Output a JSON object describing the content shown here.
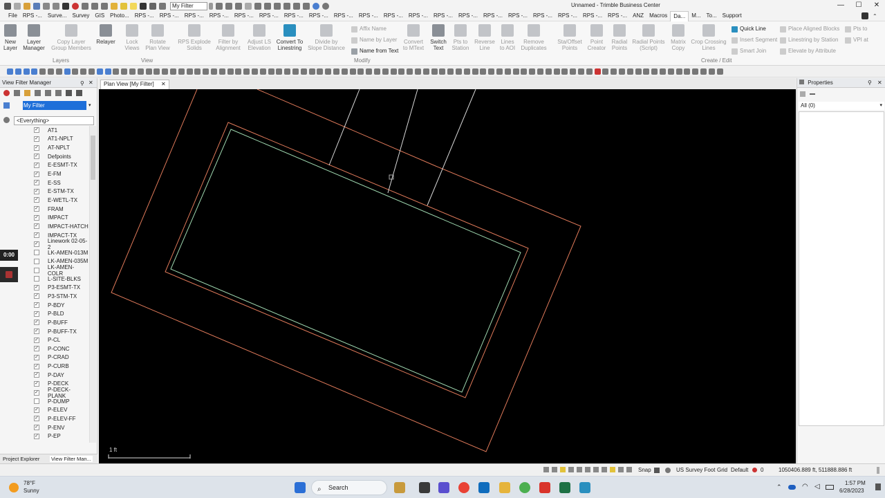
{
  "titlebar": {
    "filter_value": "My Filter",
    "app_title": "Unnamed - Trimble Business Center",
    "min": "—",
    "max": "☐",
    "close": "✕"
  },
  "menu": {
    "items": [
      "File",
      "RPS -...",
      "Surve...",
      "Survey",
      "GIS",
      "Photo...",
      "RPS -...",
      "RPS -...",
      "RPS -...",
      "RPS -...",
      "RPS -...",
      "RPS -...",
      "RPS -...",
      "RPS -...",
      "RPS -...",
      "RPS -...",
      "RPS -...",
      "RPS -...",
      "RPS -...",
      "RPS -...",
      "RPS -...",
      "RPS -...",
      "RPS -...",
      "RPS -...",
      "RPS -...",
      "RPS -...",
      "ANZ",
      "Macros",
      "Da...",
      "M...",
      "To...",
      "Support"
    ],
    "active_index": 28
  },
  "ribbon": {
    "layers": [
      {
        "label": "New\nLayer"
      },
      {
        "label": "Layer\nManager"
      },
      {
        "label": "Copy Layer\nGroup Members"
      },
      {
        "label": "Relayer"
      }
    ],
    "view": [
      {
        "label": "Lock\nViews"
      },
      {
        "label": "Rotate\nPlan View"
      }
    ],
    "modify": [
      {
        "label": "RPS Explode\nSolids"
      },
      {
        "label": "Filter by\nAlignment"
      },
      {
        "label": "Adjust LS\nElevation"
      },
      {
        "label": "Convert To\nLinestring"
      },
      {
        "label": "Divide by\nSlope Distance"
      }
    ],
    "modify_small": [
      "Affix Name",
      "Name by Layer",
      "Name from Text"
    ],
    "modify2": [
      {
        "label": "Convert\nto MText"
      },
      {
        "label": "Switch\nText"
      },
      {
        "label": "Pts to\nStation"
      },
      {
        "label": "Reverse\nLine"
      },
      {
        "label": "Lines\nto AOI"
      },
      {
        "label": "Remove\nDuplicates"
      }
    ],
    "create": [
      {
        "label": "Sta/Offset\nPoints"
      },
      {
        "label": "Point\nCreator"
      },
      {
        "label": "Radial\nPoints"
      },
      {
        "label": "Radial Points\n(Script)"
      },
      {
        "label": "Matrix\nCopy"
      },
      {
        "label": "Crop Crossing\nLines"
      }
    ],
    "create_small": [
      "Quick Line",
      "Insert Segment",
      "Smart Join"
    ],
    "create_small2": [
      "Place Aligned Blocks",
      "Linestring by Station",
      "Elevate by Attribute"
    ],
    "create_small3": [
      "Pts to",
      "VPI at"
    ],
    "group_layers": "Layers",
    "group_view": "View",
    "group_modify": "Modify",
    "group_create": "Create / Edit"
  },
  "left_panel": {
    "title": "View Filter Manager",
    "filter_name": "My Filter",
    "everything": "<Everything>",
    "timer": "0:00",
    "layers": [
      {
        "name": "AT1",
        "checked": true
      },
      {
        "name": "AT1-NPLT",
        "checked": true
      },
      {
        "name": "AT-NPLT",
        "checked": true
      },
      {
        "name": "Defpoints",
        "checked": true
      },
      {
        "name": "E-ESMT-TX",
        "checked": true
      },
      {
        "name": "E-FM",
        "checked": true
      },
      {
        "name": "E-SS",
        "checked": true
      },
      {
        "name": "E-STM-TX",
        "checked": true
      },
      {
        "name": "E-WETL-TX",
        "checked": true
      },
      {
        "name": "FRAM",
        "checked": true
      },
      {
        "name": "IMPACT",
        "checked": true
      },
      {
        "name": "IMPACT-HATCH",
        "checked": true
      },
      {
        "name": "IMPACT-TX",
        "checked": true
      },
      {
        "name": "Linework 02-05-2",
        "checked": true
      },
      {
        "name": "LK-AMEN-013M",
        "checked": false
      },
      {
        "name": "LK-AMEN-035M",
        "checked": false
      },
      {
        "name": "LK-AMEN-COLR",
        "checked": false
      },
      {
        "name": "L-SITE-BLKS",
        "checked": false
      },
      {
        "name": "P3-ESMT-TX",
        "checked": true
      },
      {
        "name": "P3-STM-TX",
        "checked": true
      },
      {
        "name": "P-BDY",
        "checked": true
      },
      {
        "name": "P-BLD",
        "checked": true
      },
      {
        "name": "P-BUFF",
        "checked": true
      },
      {
        "name": "P-BUFF-TX",
        "checked": true
      },
      {
        "name": "P-CL",
        "checked": true
      },
      {
        "name": "P-CONC",
        "checked": true
      },
      {
        "name": "P-CRAD",
        "checked": true
      },
      {
        "name": "P-CURB",
        "checked": true
      },
      {
        "name": "P-DAY",
        "checked": true
      },
      {
        "name": "P-DECK",
        "checked": true
      },
      {
        "name": "P-DECK-PLANK",
        "checked": true
      },
      {
        "name": "P-DUMP",
        "checked": false
      },
      {
        "name": "P-ELEV",
        "checked": true
      },
      {
        "name": "P-ELEV-FF",
        "checked": true
      },
      {
        "name": "P-ENV",
        "checked": true
      },
      {
        "name": "P-EP",
        "checked": true
      }
    ],
    "bottom_tabs": [
      "Project Explorer",
      "View Filter Man..."
    ]
  },
  "canvas": {
    "tab_label": "Plan View [My Filter]",
    "scale_label": "1 ft"
  },
  "right_panel": {
    "title": "Properties",
    "selection": "All (0)"
  },
  "status": {
    "snap": "Snap",
    "units": "US Survey Foot",
    "grid": "Grid",
    "default": "Default",
    "count": "0",
    "coords": "1050406.889 ft, 511888.886 ft"
  },
  "taskbar": {
    "temp": "78°F",
    "weather": "Sunny",
    "search": "Search",
    "time": "1:57 PM",
    "date": "6/28/2023"
  },
  "colors": {
    "outer_line": "#e07a5a",
    "inner_line": "#9fd8b0",
    "white_line": "#d9d9d9",
    "accent": "#1e6fd9"
  }
}
